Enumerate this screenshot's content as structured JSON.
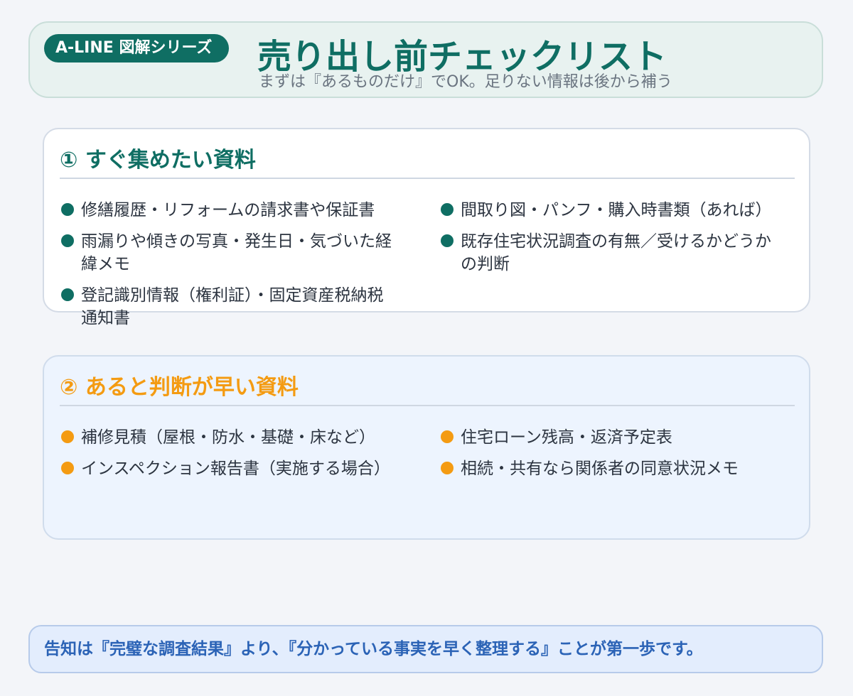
{
  "header": {
    "badge": "A-LINE 図解シリーズ",
    "title": "売り出し前チェックリスト",
    "subtitle": "まずは『あるものだけ』でOK。足りない情報は後から補う"
  },
  "section1": {
    "title": "① すぐ集めたい資料",
    "left_items": [
      "修繕履歴・リフォームの請求書や保証書",
      "雨漏りや傾きの写真・発生日・気づいた経緯メモ",
      "登記識別情報（権利証）・固定資産税納税通知書"
    ],
    "right_items": [
      "間取り図・パンフ・購入時書類（あれば）",
      "既存住宅状況調査の有無／受けるかどうかの判断"
    ]
  },
  "section2": {
    "title": "② あると判断が早い資料",
    "left_items": [
      "補修見積（屋根・防水・基礎・床など）",
      "インスペクション報告書（実施する場合）"
    ],
    "right_items": [
      "住宅ローン残高・返済予定表",
      "相続・共有なら関係者の同意状況メモ"
    ]
  },
  "footer": {
    "text": "告知は『完璧な調査結果』より、『分かっている事実を早く整理する』ことが第一歩です。"
  },
  "colors": {
    "teal": "#0f6e63",
    "orange": "#f49b12",
    "footer_blue": "#2b63b6"
  }
}
